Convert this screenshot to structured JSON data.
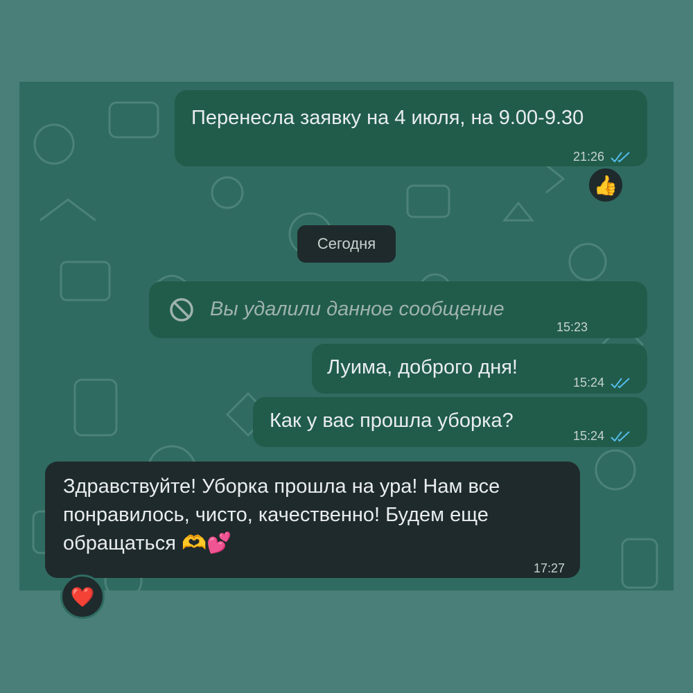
{
  "date_divider": "Сегодня",
  "messages": [
    {
      "text": "Перенесла заявку на 4 июля, на 9.00-9.30",
      "time": "21:26",
      "reaction": "👍"
    },
    {
      "text": "Вы удалили данное сообщение",
      "time": "15:23"
    },
    {
      "text": "Луима, доброго дня!",
      "time": "15:24"
    },
    {
      "text": "Как у вас прошла уборка?",
      "time": "15:24"
    },
    {
      "lines": [
        "Здравствуйте! Уборка прошла на ура! Нам все",
        "понравилось, чисто, качественно! Будем еще",
        "обращаться 🫶💕"
      ],
      "time": "17:27",
      "reaction": "❤️"
    }
  ],
  "colors": {
    "outgoing": "#215c4b",
    "incoming": "#1f2a2c",
    "read_ticks": "#53bdeb"
  }
}
